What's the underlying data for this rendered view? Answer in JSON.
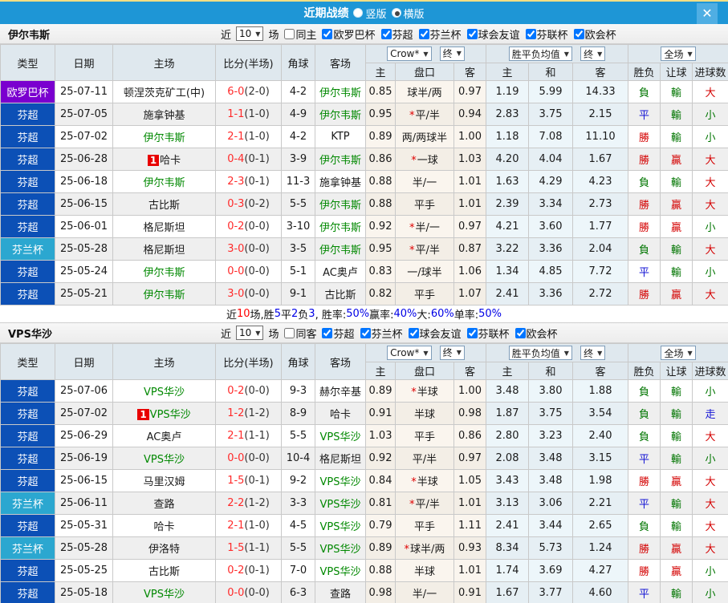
{
  "titlebar": {
    "title": "近期战绩",
    "radio_vertical": "竖版",
    "radio_horizontal": "横版",
    "close": "✕"
  },
  "header": {
    "type": "类型",
    "date": "日期",
    "home": "主场",
    "score": "比分(半场)",
    "corner": "角球",
    "away": "客场",
    "odds_source": "Crow*",
    "odds_final": "终",
    "mean_source": "胜平负均值",
    "mean_final": "终",
    "scope": "全场",
    "sub_home": "主",
    "sub_handicap": "盘口",
    "sub_away": "客",
    "sub_mhome": "主",
    "sub_mdraw": "和",
    "sub_maway": "客",
    "sub_result": "胜负",
    "sub_let": "让球",
    "sub_goals": "进球数"
  },
  "type_colors": {
    "欧罗巴杯": "#7A00CF",
    "芬超": "#0C50B6",
    "芬兰杯": "#2BA7D0"
  },
  "result_colors": {
    "red": "#D40000",
    "blue": "#1414D4",
    "green": "#007500"
  },
  "sections": [
    {
      "team": "伊尔韦斯",
      "near_label": "近",
      "count": "10",
      "games_label": "场",
      "same_label": "同主",
      "leagues": [
        "欧罗巴杯",
        "芬超",
        "芬兰杯",
        "球会友谊",
        "芬联杯",
        "欧会杯"
      ],
      "rows": [
        {
          "type": "欧罗巴杯",
          "date": "25-07-11",
          "home": "顿涅茨克矿工(中)",
          "home_focal": false,
          "home_badge": "",
          "score": "6-0",
          "half": "(2-0)",
          "corner": "4-2",
          "away": "伊尔韦斯",
          "away_focal": true,
          "odds_home": "0.85",
          "handicap_star": false,
          "handicap": "球半/两",
          "odds_away": "0.97",
          "mean_home": "1.19",
          "mean_draw": "5.99",
          "mean_away": "14.33",
          "result": "負",
          "result_c": "green",
          "let": "輸",
          "let_c": "green",
          "goals": "大",
          "goals_c": "red"
        },
        {
          "type": "芬超",
          "date": "25-07-05",
          "home": "施拿钟基",
          "home_focal": false,
          "home_badge": "",
          "score": "1-1",
          "half": "(1-0)",
          "corner": "4-9",
          "away": "伊尔韦斯",
          "away_focal": true,
          "odds_home": "0.95",
          "handicap_star": true,
          "handicap": "平/半",
          "odds_away": "0.94",
          "mean_home": "2.83",
          "mean_draw": "3.75",
          "mean_away": "2.15",
          "result": "平",
          "result_c": "blue",
          "let": "輸",
          "let_c": "green",
          "goals": "小",
          "goals_c": "green"
        },
        {
          "type": "芬超",
          "date": "25-07-02",
          "home": "伊尔韦斯",
          "home_focal": true,
          "home_badge": "",
          "score": "2-1",
          "half": "(1-0)",
          "corner": "4-2",
          "away": "KTP",
          "away_focal": false,
          "odds_home": "0.89",
          "handicap_star": false,
          "handicap": "两/两球半",
          "odds_away": "1.00",
          "mean_home": "1.18",
          "mean_draw": "7.08",
          "mean_away": "11.10",
          "result": "勝",
          "result_c": "red",
          "let": "輸",
          "let_c": "green",
          "goals": "小",
          "goals_c": "green"
        },
        {
          "type": "芬超",
          "date": "25-06-28",
          "home": "哈卡",
          "home_focal": false,
          "home_badge": "1",
          "score": "0-4",
          "half": "(0-1)",
          "corner": "3-9",
          "away": "伊尔韦斯",
          "away_focal": true,
          "odds_home": "0.86",
          "handicap_star": true,
          "handicap": "一球",
          "odds_away": "1.03",
          "mean_home": "4.20",
          "mean_draw": "4.04",
          "mean_away": "1.67",
          "result": "勝",
          "result_c": "red",
          "let": "贏",
          "let_c": "red",
          "goals": "大",
          "goals_c": "red"
        },
        {
          "type": "芬超",
          "date": "25-06-18",
          "home": "伊尔韦斯",
          "home_focal": true,
          "home_badge": "",
          "score": "2-3",
          "half": "(0-1)",
          "corner": "11-3",
          "away": "施拿钟基",
          "away_focal": false,
          "odds_home": "0.88",
          "handicap_star": false,
          "handicap": "半/一",
          "odds_away": "1.01",
          "mean_home": "1.63",
          "mean_draw": "4.29",
          "mean_away": "4.23",
          "result": "負",
          "result_c": "green",
          "let": "輸",
          "let_c": "green",
          "goals": "大",
          "goals_c": "red"
        },
        {
          "type": "芬超",
          "date": "25-06-15",
          "home": "古比斯",
          "home_focal": false,
          "home_badge": "",
          "score": "0-3",
          "half": "(0-2)",
          "corner": "5-5",
          "away": "伊尔韦斯",
          "away_focal": true,
          "odds_home": "0.88",
          "handicap_star": false,
          "handicap": "平手",
          "odds_away": "1.01",
          "mean_home": "2.39",
          "mean_draw": "3.34",
          "mean_away": "2.73",
          "result": "勝",
          "result_c": "red",
          "let": "贏",
          "let_c": "red",
          "goals": "大",
          "goals_c": "red"
        },
        {
          "type": "芬超",
          "date": "25-06-01",
          "home": "格尼斯坦",
          "home_focal": false,
          "home_badge": "",
          "score": "0-2",
          "half": "(0-0)",
          "corner": "3-10",
          "away": "伊尔韦斯",
          "away_focal": true,
          "odds_home": "0.92",
          "handicap_star": true,
          "handicap": "半/一",
          "odds_away": "0.97",
          "mean_home": "4.21",
          "mean_draw": "3.60",
          "mean_away": "1.77",
          "result": "勝",
          "result_c": "red",
          "let": "贏",
          "let_c": "red",
          "goals": "小",
          "goals_c": "green"
        },
        {
          "type": "芬兰杯",
          "date": "25-05-28",
          "home": "格尼斯坦",
          "home_focal": false,
          "home_badge": "",
          "score": "3-0",
          "half": "(0-0)",
          "corner": "3-5",
          "away": "伊尔韦斯",
          "away_focal": true,
          "odds_home": "0.95",
          "handicap_star": true,
          "handicap": "平/半",
          "odds_away": "0.87",
          "mean_home": "3.22",
          "mean_draw": "3.36",
          "mean_away": "2.04",
          "result": "負",
          "result_c": "green",
          "let": "輸",
          "let_c": "green",
          "goals": "大",
          "goals_c": "red"
        },
        {
          "type": "芬超",
          "date": "25-05-24",
          "home": "伊尔韦斯",
          "home_focal": true,
          "home_badge": "",
          "score": "0-0",
          "half": "(0-0)",
          "corner": "5-1",
          "away": "AC奥卢",
          "away_focal": false,
          "odds_home": "0.83",
          "handicap_star": false,
          "handicap": "一/球半",
          "odds_away": "1.06",
          "mean_home": "1.34",
          "mean_draw": "4.85",
          "mean_away": "7.72",
          "result": "平",
          "result_c": "blue",
          "let": "輸",
          "let_c": "green",
          "goals": "小",
          "goals_c": "green"
        },
        {
          "type": "芬超",
          "date": "25-05-21",
          "home": "伊尔韦斯",
          "home_focal": true,
          "home_badge": "",
          "score": "3-0",
          "half": "(0-0)",
          "corner": "9-1",
          "away": "古比斯",
          "away_focal": false,
          "odds_home": "0.82",
          "handicap_star": false,
          "handicap": "平手",
          "odds_away": "1.07",
          "mean_home": "2.41",
          "mean_draw": "3.36",
          "mean_away": "2.72",
          "result": "勝",
          "result_c": "red",
          "let": "贏",
          "let_c": "red",
          "goals": "大",
          "goals_c": "red"
        }
      ],
      "summary_parts": [
        {
          "t": "近",
          "c": "k"
        },
        {
          "t": "10",
          "c": "r"
        },
        {
          "t": "场,胜",
          "c": "k"
        },
        {
          "t": "5",
          "c": "b"
        },
        {
          "t": "平",
          "c": "k"
        },
        {
          "t": "2",
          "c": "b"
        },
        {
          "t": "负",
          "c": "k"
        },
        {
          "t": "3",
          "c": "b"
        },
        {
          "t": ", 胜率:",
          "c": "k"
        },
        {
          "t": "50%",
          "c": "b"
        },
        {
          "t": " 赢率:",
          "c": "k"
        },
        {
          "t": "40%",
          "c": "b"
        },
        {
          "t": " 大:",
          "c": "k"
        },
        {
          "t": "60%",
          "c": "b"
        },
        {
          "t": " 单率:",
          "c": "k"
        },
        {
          "t": "50%",
          "c": "b"
        }
      ]
    },
    {
      "team": "VPS华沙",
      "near_label": "近",
      "count": "10",
      "games_label": "场",
      "same_label": "同客",
      "leagues": [
        "芬超",
        "芬兰杯",
        "球会友谊",
        "芬联杯",
        "欧会杯"
      ],
      "rows": [
        {
          "type": "芬超",
          "date": "25-07-06",
          "home": "VPS华沙",
          "home_focal": true,
          "home_badge": "",
          "score": "0-2",
          "half": "(0-0)",
          "corner": "9-3",
          "away": "赫尔辛基",
          "away_focal": false,
          "odds_home": "0.89",
          "handicap_star": true,
          "handicap": "半球",
          "odds_away": "1.00",
          "mean_home": "3.48",
          "mean_draw": "3.80",
          "mean_away": "1.88",
          "result": "負",
          "result_c": "green",
          "let": "輸",
          "let_c": "green",
          "goals": "小",
          "goals_c": "green"
        },
        {
          "type": "芬超",
          "date": "25-07-02",
          "home": "VPS华沙",
          "home_focal": true,
          "home_badge": "1",
          "score": "1-2",
          "half": "(1-2)",
          "corner": "8-9",
          "away": "哈卡",
          "away_focal": false,
          "odds_home": "0.91",
          "handicap_star": false,
          "handicap": "半球",
          "odds_away": "0.98",
          "mean_home": "1.87",
          "mean_draw": "3.75",
          "mean_away": "3.54",
          "result": "負",
          "result_c": "green",
          "let": "輸",
          "let_c": "green",
          "goals": "走",
          "goals_c": "blue"
        },
        {
          "type": "芬超",
          "date": "25-06-29",
          "home": "AC奥卢",
          "home_focal": false,
          "home_badge": "",
          "score": "2-1",
          "half": "(1-1)",
          "corner": "5-5",
          "away": "VPS华沙",
          "away_focal": true,
          "odds_home": "1.03",
          "handicap_star": false,
          "handicap": "平手",
          "odds_away": "0.86",
          "mean_home": "2.80",
          "mean_draw": "3.23",
          "mean_away": "2.40",
          "result": "負",
          "result_c": "green",
          "let": "輸",
          "let_c": "green",
          "goals": "大",
          "goals_c": "red"
        },
        {
          "type": "芬超",
          "date": "25-06-19",
          "home": "VPS华沙",
          "home_focal": true,
          "home_badge": "",
          "score": "0-0",
          "half": "(0-0)",
          "corner": "10-4",
          "away": "格尼斯坦",
          "away_focal": false,
          "odds_home": "0.92",
          "handicap_star": false,
          "handicap": "平/半",
          "odds_away": "0.97",
          "mean_home": "2.08",
          "mean_draw": "3.48",
          "mean_away": "3.15",
          "result": "平",
          "result_c": "blue",
          "let": "輸",
          "let_c": "green",
          "goals": "小",
          "goals_c": "green"
        },
        {
          "type": "芬超",
          "date": "25-06-15",
          "home": "马里汉姆",
          "home_focal": false,
          "home_badge": "",
          "score": "1-5",
          "half": "(0-1)",
          "corner": "9-2",
          "away": "VPS华沙",
          "away_focal": true,
          "odds_home": "0.84",
          "handicap_star": true,
          "handicap": "半球",
          "odds_away": "1.05",
          "mean_home": "3.43",
          "mean_draw": "3.48",
          "mean_away": "1.98",
          "result": "勝",
          "result_c": "red",
          "let": "贏",
          "let_c": "red",
          "goals": "大",
          "goals_c": "red"
        },
        {
          "type": "芬兰杯",
          "date": "25-06-11",
          "home": "查路",
          "home_focal": false,
          "home_badge": "",
          "score": "2-2",
          "half": "(1-2)",
          "corner": "3-3",
          "away": "VPS华沙",
          "away_focal": true,
          "odds_home": "0.81",
          "handicap_star": true,
          "handicap": "平/半",
          "odds_away": "1.01",
          "mean_home": "3.13",
          "mean_draw": "3.06",
          "mean_away": "2.21",
          "result": "平",
          "result_c": "blue",
          "let": "輸",
          "let_c": "green",
          "goals": "大",
          "goals_c": "red"
        },
        {
          "type": "芬超",
          "date": "25-05-31",
          "home": "哈卡",
          "home_focal": false,
          "home_badge": "",
          "score": "2-1",
          "half": "(1-0)",
          "corner": "4-5",
          "away": "VPS华沙",
          "away_focal": true,
          "odds_home": "0.79",
          "handicap_star": false,
          "handicap": "平手",
          "odds_away": "1.11",
          "mean_home": "2.41",
          "mean_draw": "3.44",
          "mean_away": "2.65",
          "result": "負",
          "result_c": "green",
          "let": "輸",
          "let_c": "green",
          "goals": "大",
          "goals_c": "red"
        },
        {
          "type": "芬兰杯",
          "date": "25-05-28",
          "home": "伊洛特",
          "home_focal": false,
          "home_badge": "",
          "score": "1-5",
          "half": "(1-1)",
          "corner": "5-5",
          "away": "VPS华沙",
          "away_focal": true,
          "odds_home": "0.89",
          "handicap_star": true,
          "handicap": "球半/两",
          "odds_away": "0.93",
          "mean_home": "8.34",
          "mean_draw": "5.73",
          "mean_away": "1.24",
          "result": "勝",
          "result_c": "red",
          "let": "贏",
          "let_c": "red",
          "goals": "大",
          "goals_c": "red"
        },
        {
          "type": "芬超",
          "date": "25-05-25",
          "home": "古比斯",
          "home_focal": false,
          "home_badge": "",
          "score": "0-2",
          "half": "(0-1)",
          "corner": "7-0",
          "away": "VPS华沙",
          "away_focal": true,
          "odds_home": "0.88",
          "handicap_star": false,
          "handicap": "半球",
          "odds_away": "1.01",
          "mean_home": "1.74",
          "mean_draw": "3.69",
          "mean_away": "4.27",
          "result": "勝",
          "result_c": "red",
          "let": "贏",
          "let_c": "red",
          "goals": "小",
          "goals_c": "green"
        },
        {
          "type": "芬超",
          "date": "25-05-18",
          "home": "VPS华沙",
          "home_focal": true,
          "home_badge": "",
          "score": "0-0",
          "half": "(0-0)",
          "corner": "6-3",
          "away": "查路",
          "away_focal": false,
          "odds_home": "0.98",
          "handicap_star": false,
          "handicap": "半/一",
          "odds_away": "0.91",
          "mean_home": "1.67",
          "mean_draw": "3.77",
          "mean_away": "4.60",
          "result": "平",
          "result_c": "blue",
          "let": "輸",
          "let_c": "green",
          "goals": "小",
          "goals_c": "green"
        }
      ]
    }
  ]
}
